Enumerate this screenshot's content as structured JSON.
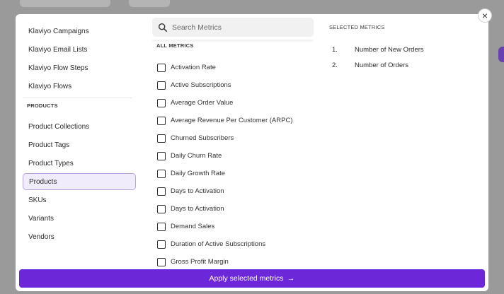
{
  "modal": {
    "close_label": "×"
  },
  "left_nav": {
    "items_top": [
      {
        "label": "Klaviyo Campaigns"
      },
      {
        "label": "Klaviyo Email Lists"
      },
      {
        "label": "Klaviyo Flow Steps"
      },
      {
        "label": "Klaviyo Flows"
      }
    ],
    "section_heading": "PRODUCTS",
    "items_products": [
      {
        "label": "Product Collections"
      },
      {
        "label": "Product Tags"
      },
      {
        "label": "Product Types"
      },
      {
        "label": "Products",
        "active": true
      },
      {
        "label": "SKUs"
      },
      {
        "label": "Variants"
      },
      {
        "label": "Vendors"
      }
    ]
  },
  "search": {
    "placeholder": "Search Metrics",
    "icon": "search-icon"
  },
  "all_metrics": {
    "heading": "ALL METRICS",
    "items": [
      "Activation Rate",
      "Active Subscriptions",
      "Average Order Value",
      "Average Revenue Per Customer (ARPC)",
      "Churned Subscribers",
      "Daily Churn Rate",
      "Daily Growth Rate",
      "Days to Activation",
      "Days to Activation",
      "Demand Sales",
      "Duration of Active Subscriptions",
      "Gross Profit Margin"
    ]
  },
  "selected_metrics": {
    "heading": "SELECTED METRICS",
    "items": [
      {
        "num": "1.",
        "label": "Number of New Orders"
      },
      {
        "num": "2.",
        "label": "Number of Orders"
      }
    ]
  },
  "apply_button": {
    "label": "Apply selected metrics",
    "arrow": "→"
  },
  "colors": {
    "accent": "#6c27d8",
    "active_bg": "#f1ecfb",
    "active_border": "#b7a3dc"
  }
}
